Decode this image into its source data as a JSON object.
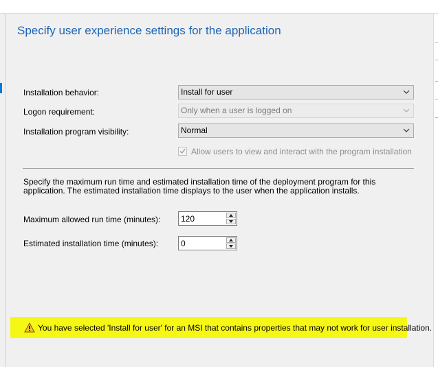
{
  "title": "Specify user experience settings for the application",
  "fields": {
    "installation_behavior": {
      "label": "Installation behavior:",
      "value": "Install for user"
    },
    "logon_requirement": {
      "label": "Logon requirement:",
      "value": "Only when a user is logged on"
    },
    "program_visibility": {
      "label": "Installation program visibility:",
      "value": "Normal"
    }
  },
  "allow_interact": {
    "label": "Allow users to view and interact with the program installation",
    "checked": true,
    "enabled": false
  },
  "description": "Specify the maximum run time and estimated installation time of the deployment program for this application. The estimated installation time displays to the user when the application installs.",
  "max_run_time": {
    "label": "Maximum allowed run time (minutes):",
    "value": "120"
  },
  "estimated_time": {
    "label": "Estimated installation time (minutes):",
    "value": "0"
  },
  "warning": {
    "icon": "warning-icon",
    "text": "You have selected 'Install for user' for an MSI that contains properties that may not work for user installation."
  },
  "colors": {
    "title": "#1e64b4",
    "warning_bg": "#f7f716",
    "accent": "#0078d7"
  }
}
